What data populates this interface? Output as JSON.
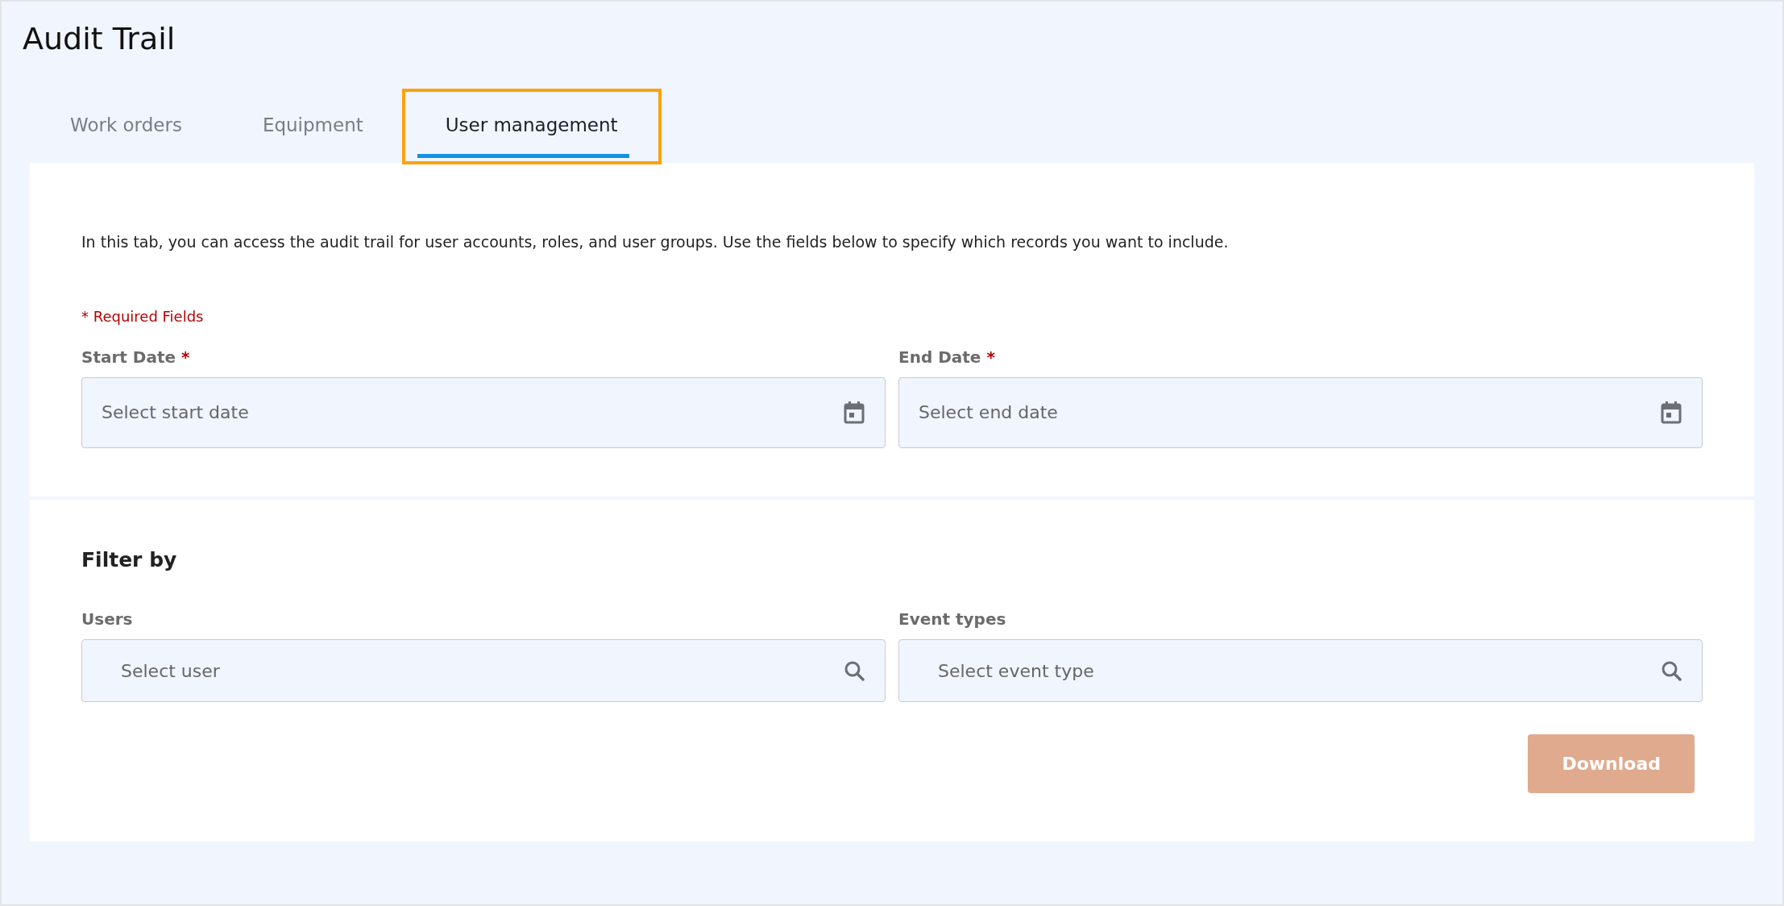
{
  "page": {
    "title": "Audit Trail"
  },
  "tabs": [
    {
      "label": "Work orders",
      "selected": false,
      "highlighted": false
    },
    {
      "label": "Equipment",
      "selected": false,
      "highlighted": false
    },
    {
      "label": "User management",
      "selected": true,
      "highlighted": true
    }
  ],
  "intro": "In this tab, you can access the audit trail for user accounts, roles, and user groups. Use the fields below to specify which records you want to include.",
  "required_note": "* Required Fields",
  "date_fields": [
    {
      "label": "Start Date",
      "required_mark": "*",
      "placeholder": "Select start date"
    },
    {
      "label": "End Date",
      "required_mark": "*",
      "placeholder": "Select end date"
    }
  ],
  "filter": {
    "heading": "Filter by",
    "fields": [
      {
        "label": "Users",
        "placeholder": "Select user"
      },
      {
        "label": "Event types",
        "placeholder": "Select event type"
      }
    ]
  },
  "download_button": {
    "label": "Download",
    "disabled": true
  }
}
